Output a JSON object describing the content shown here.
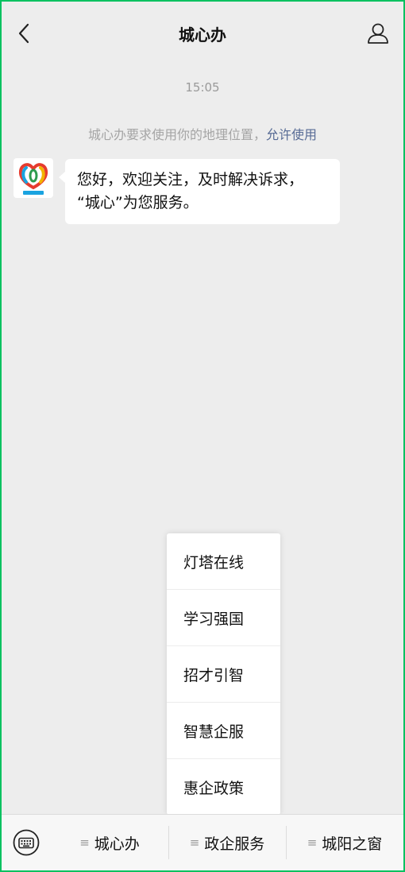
{
  "header": {
    "title": "城心办",
    "back_icon": "chevron-left-icon",
    "profile_icon": "user-icon"
  },
  "chat": {
    "timestamp": "15:05",
    "system_message": {
      "text": "城心办要求使用你的地理位置，",
      "link": "允许使用"
    },
    "messages": [
      {
        "sender": "城心办",
        "line1": "您好，欢迎关注，及时解决诉求，",
        "line2": "“城心”为您服务。"
      }
    ]
  },
  "popup_menu": {
    "items": [
      "灯塔在线",
      "学习强国",
      "招才引智",
      "智慧企服",
      "惠企政策"
    ]
  },
  "bottom_menu": {
    "keyboard_icon": "keyboard-icon",
    "menu_icon": "menu-lines-icon",
    "menu_glyph": "≡",
    "tabs": [
      "城心办",
      "政企服务",
      "城阳之窗"
    ]
  },
  "colors": {
    "accent": "#07c160",
    "link": "#576b95",
    "background": "#ededed"
  }
}
